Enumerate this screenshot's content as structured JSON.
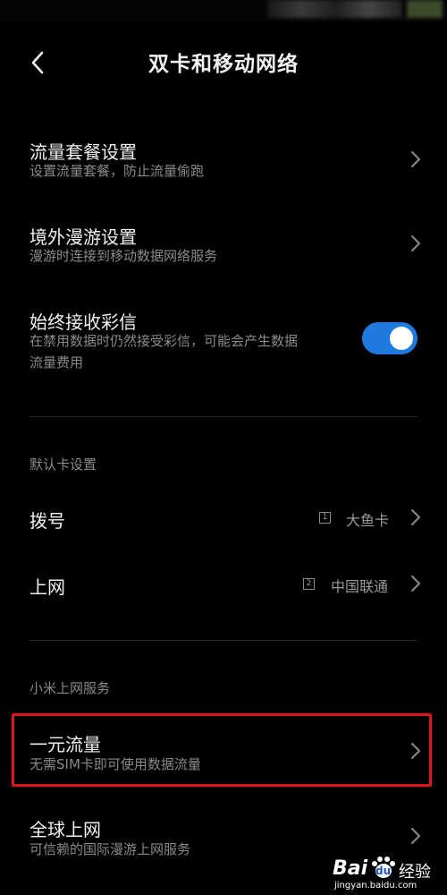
{
  "header": {
    "title": "双卡和移动网络"
  },
  "rows": [
    {
      "title": "流量套餐设置",
      "subtitle": "设置流量套餐，防止流量偷跑"
    },
    {
      "title": "境外漫游设置",
      "subtitle": "漫游时连接到移动数据网络服务"
    },
    {
      "title": "始终接收彩信",
      "subtitle_line1": "在禁用数据时仍然接受彩信，可能会产生数据",
      "subtitle_line2": "流量费用",
      "toggle_on": true
    }
  ],
  "default_card": {
    "label": "默认卡设置",
    "dial": {
      "title": "拨号",
      "sim": "1",
      "value": "大鱼卡"
    },
    "internet": {
      "title": "上网",
      "sim": "2",
      "value": "中国联通"
    }
  },
  "xiaomi": {
    "label": "小米上网服务",
    "items": [
      {
        "title": "一元流量",
        "subtitle": "无需SIM卡即可使用数据流量"
      },
      {
        "title": "全球上网",
        "subtitle": "可信赖的国际漫游上网服务"
      }
    ]
  },
  "watermark": {
    "brand": "Bai",
    "paw": "du",
    "suffix": "经验",
    "url": "jingyan.baidu.com"
  },
  "colors": {
    "background": "#000000",
    "toggle": "#1f7ae0",
    "highlight": "#e0141e"
  }
}
